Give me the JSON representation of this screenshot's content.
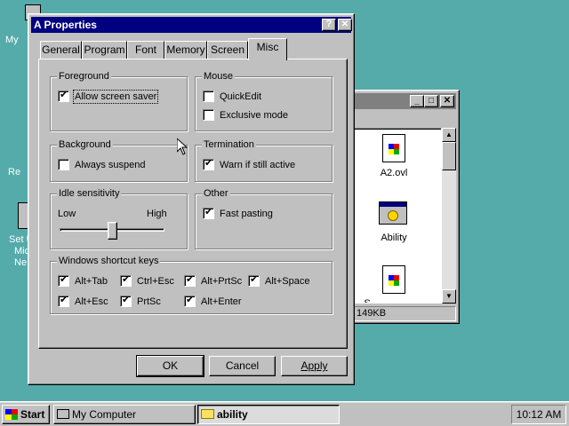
{
  "desktop": {
    "icon_labels": [
      "My",
      "Re",
      "Set U",
      "Mic",
      "Ne"
    ]
  },
  "bg_window": {
    "files": [
      {
        "name": "A2.ovl",
        "icon": "windows-file-icon"
      },
      {
        "name": "Ability",
        "icon": "program-settings-icon"
      },
      {
        "name": "S",
        "icon": "windows-file-icon"
      }
    ],
    "status": "149KB",
    "buttons": {
      "minimize": "_",
      "maximize": "□",
      "close": "✕"
    }
  },
  "dialog": {
    "title": "A Properties",
    "title_buttons": {
      "help": "?",
      "close": "✕"
    },
    "tabs": [
      "General",
      "Program",
      "Font",
      "Memory",
      "Screen",
      "Misc"
    ],
    "active_tab": "Misc",
    "foreground": {
      "title": "Foreground",
      "allow_screen_saver": {
        "label": "Allow screen saver",
        "checked": true
      }
    },
    "mouse": {
      "title": "Mouse",
      "quickedit": {
        "label": "QuickEdit",
        "checked": false
      },
      "exclusive": {
        "label": "Exclusive mode",
        "checked": false
      }
    },
    "background": {
      "title": "Background",
      "always_suspend": {
        "label": "Always suspend",
        "checked": false
      }
    },
    "termination": {
      "title": "Termination",
      "warn": {
        "label": "Warn if still active",
        "checked": true
      }
    },
    "idle": {
      "title": "Idle sensitivity",
      "low": "Low",
      "high": "High",
      "value": 0.5
    },
    "other": {
      "title": "Other",
      "fast_pasting": {
        "label": "Fast pasting",
        "checked": true
      }
    },
    "shortcuts": {
      "title": "Windows shortcut keys",
      "keys": [
        {
          "label": "Alt+Tab",
          "checked": true
        },
        {
          "label": "Ctrl+Esc",
          "checked": true
        },
        {
          "label": "Alt+PrtSc",
          "checked": true
        },
        {
          "label": "Alt+Space",
          "checked": true
        },
        {
          "label": "Alt+Esc",
          "checked": true
        },
        {
          "label": "PrtSc",
          "checked": true
        },
        {
          "label": "Alt+Enter",
          "checked": true
        }
      ]
    },
    "buttons": {
      "ok": "OK",
      "cancel": "Cancel",
      "apply": "Apply"
    }
  },
  "taskbar": {
    "start": "Start",
    "items": [
      {
        "label": "My Computer",
        "pressed": false
      },
      {
        "label": "ability",
        "pressed": true
      }
    ],
    "clock": "10:12 AM"
  },
  "colors": {
    "desktop": "#55aaaa",
    "active_title": "#000080",
    "inactive_title": "#808080",
    "face": "#c0c0c0"
  }
}
